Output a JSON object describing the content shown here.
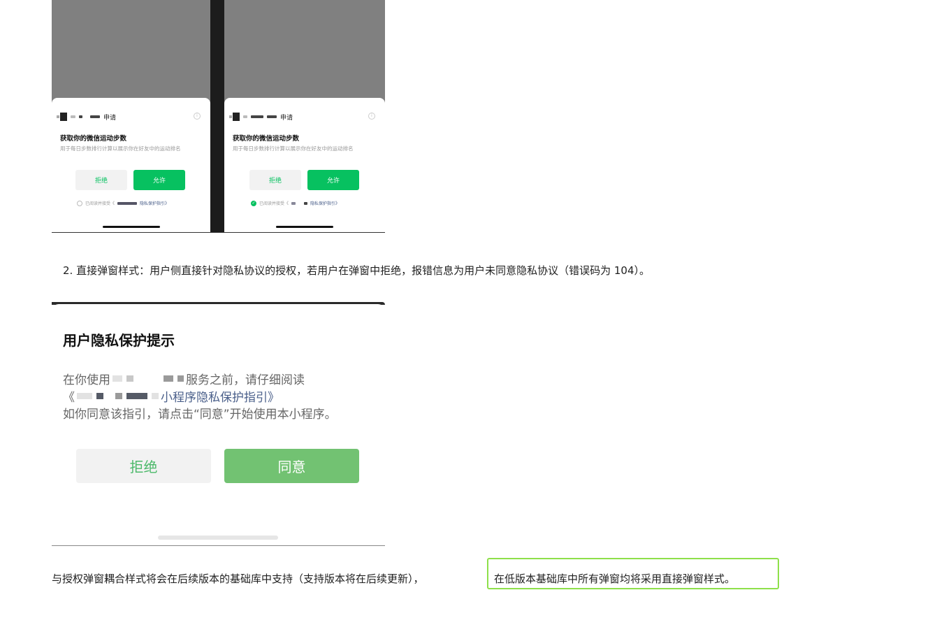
{
  "top_screenshot": {
    "apply_label": "申请",
    "permission_title": "获取你的微信运动步数",
    "permission_desc": "用于每日步数排行计算以展示你在好友中的运动排名",
    "reject_label": "拒绝",
    "allow_label": "允许",
    "agree_prefix": "已阅读并接受《",
    "privacy_guide": "隐私保护指引》",
    "info_glyph": "i",
    "left_checkbox_checked": false,
    "right_checkbox_checked": true,
    "accent_color": "#07c160"
  },
  "paragraph_direct": "2. 直接弹窗样式：用户侧直接针对隐私协议的授权，若用户在弹窗中拒绝，报错信息为用户未同意隐私协议（错误码为 104）。",
  "middle_screenshot": {
    "title": "用户隐私保护提示",
    "line1_prefix": "在你使用",
    "line1_suffix": "服务之前，请仔细阅读",
    "line2_prefix": "《",
    "line2_link": "小程序隐私保护指引》",
    "line3": "如你同意该指引，请点击“同意”开始使用本小程序。",
    "reject_label": "拒绝",
    "agree_label": "同意"
  },
  "paragraph_coupled": "与授权弹窗耦合样式将会在后续版本的基础库中支持（支持版本将在后续更新），",
  "paragraph_highlight": "在低版本基础库中所有弹窗均将采用直接弹窗样式。",
  "highlight_color": "#8ee04a"
}
